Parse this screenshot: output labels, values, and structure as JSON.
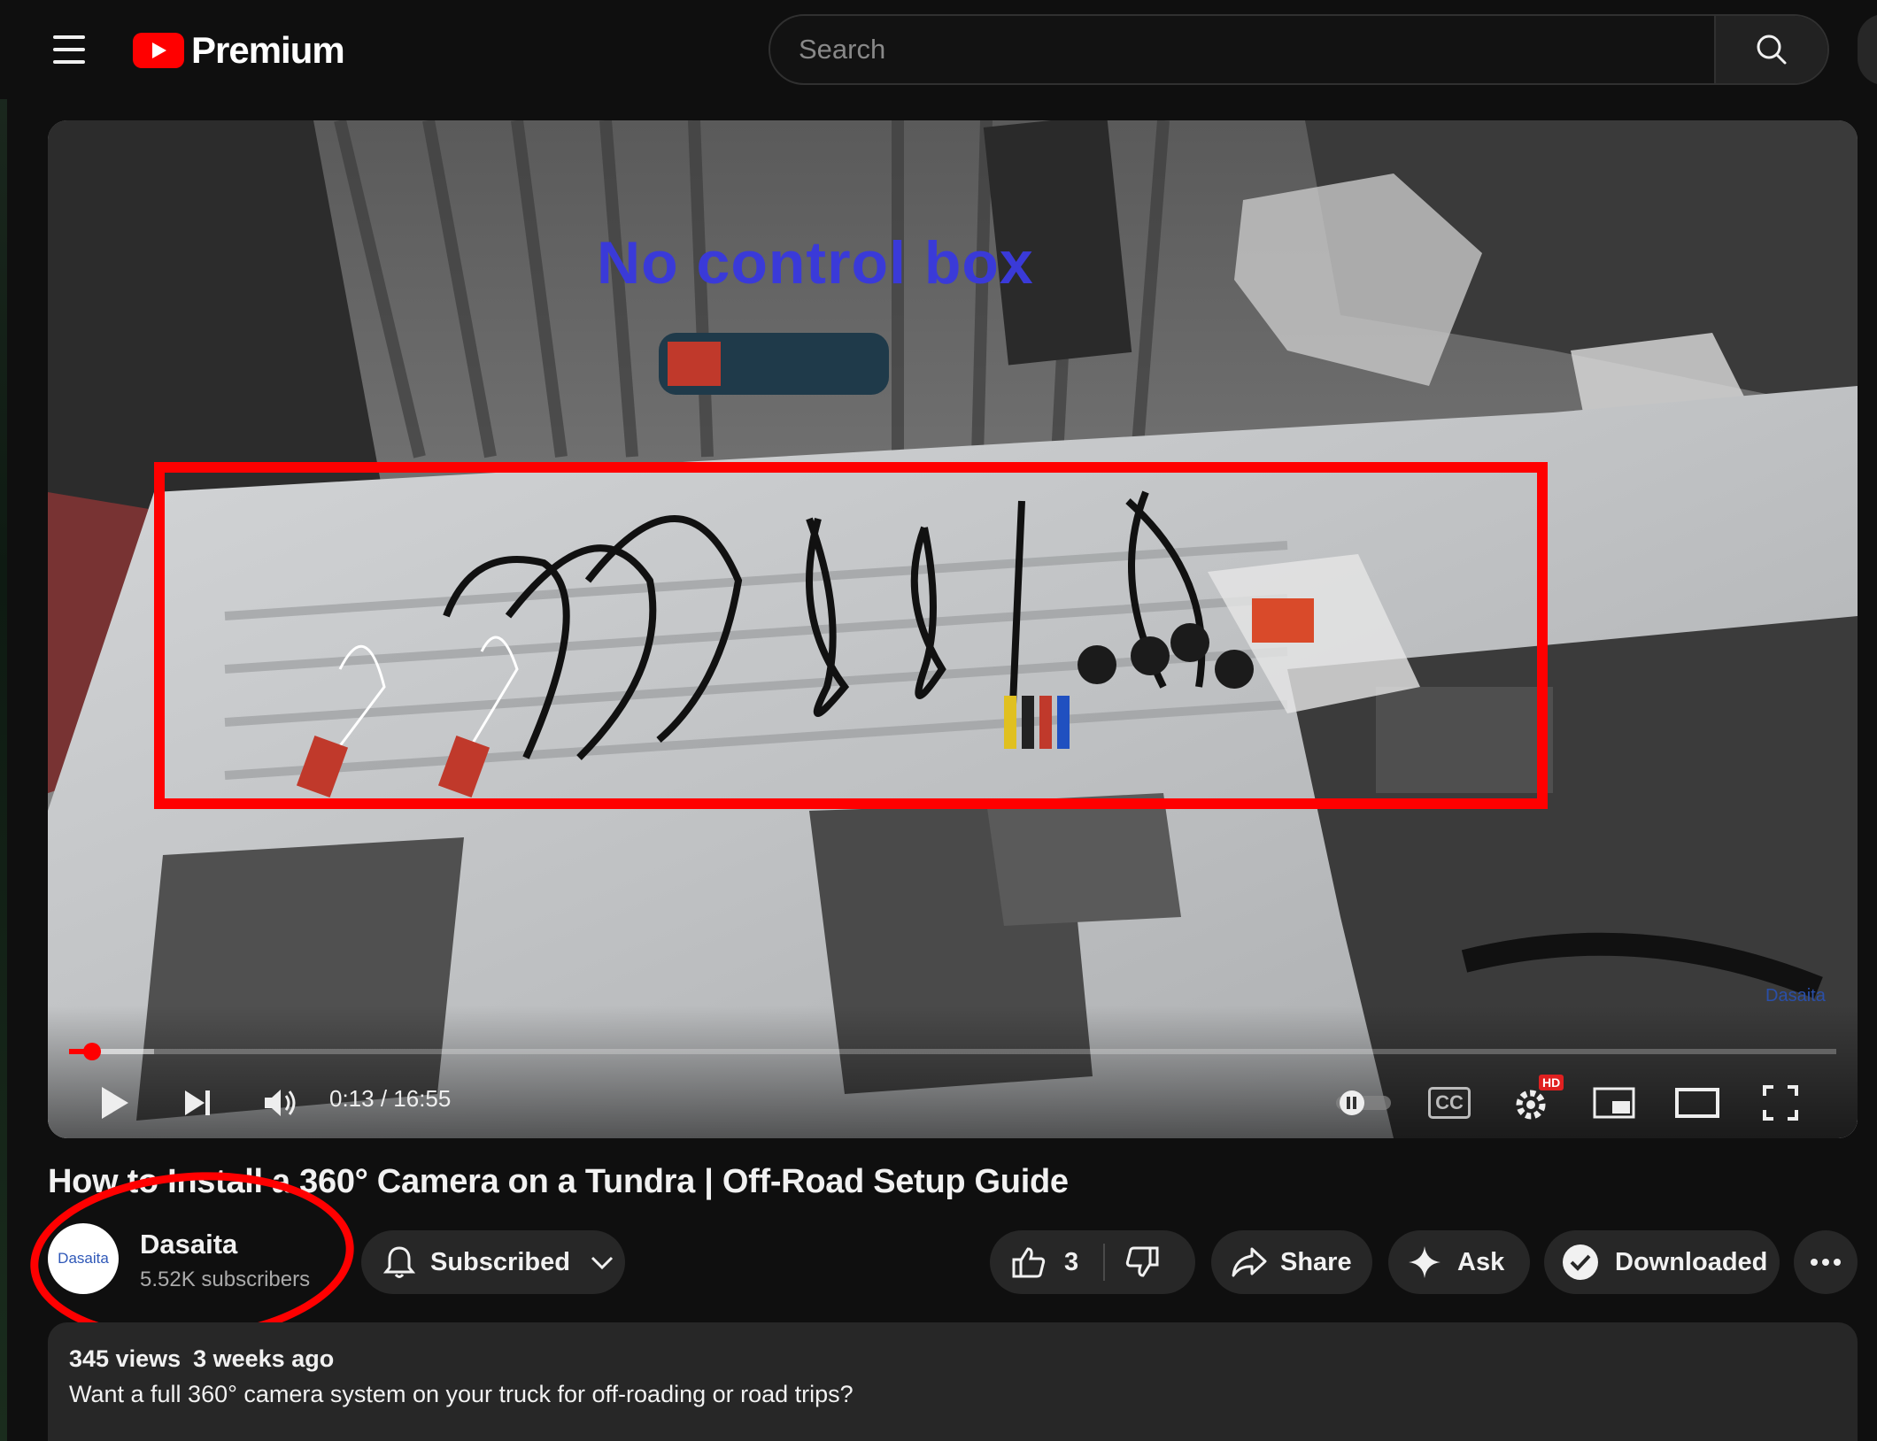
{
  "header": {
    "brand": "Premium",
    "search_placeholder": "Search"
  },
  "player": {
    "overlay_text": "No control box",
    "watermark": "Dasaita",
    "time_current": "0:13",
    "time_separator": " / ",
    "time_total": "16:55",
    "progress_played_fraction": 0.013,
    "progress_buffered_fraction": 0.048,
    "hd_badge": "HD",
    "cc_label": "CC"
  },
  "video": {
    "title": "How to Install a 360° Camera on a Tundra | Off-Road Setup Guide"
  },
  "channel": {
    "name": "Dasaita",
    "avatar_text": "Dasaita",
    "subscribers": "5.52K subscribers",
    "subscribe_label": "Subscribed"
  },
  "actions": {
    "like_count": "3",
    "share_label": "Share",
    "ask_label": "Ask",
    "download_label": "Downloaded"
  },
  "description": {
    "views": "345 views",
    "age": "3 weeks ago",
    "text": "Want a full 360° camera system on your truck for off-roading or road trips?"
  },
  "colors": {
    "background": "#0f0f0f",
    "brand_red": "#ff0000",
    "pill_bg": "#272727",
    "overlay_text": "#3a3ad8",
    "annotation_red": "#ff0000"
  }
}
